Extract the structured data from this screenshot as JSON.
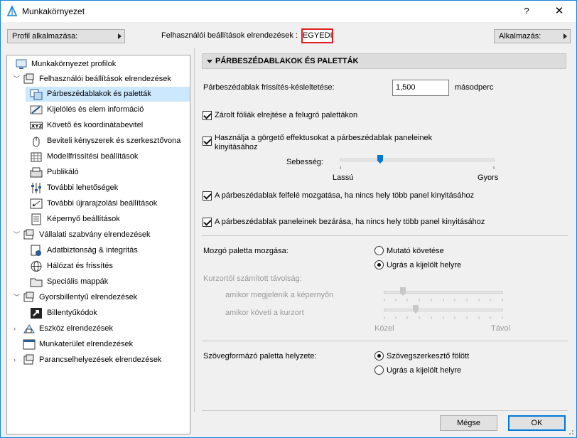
{
  "window": {
    "title": "Munkakörnyezet",
    "help": "?",
    "close": "✕"
  },
  "toolbar": {
    "profile_button": "Profil alkalmazása:",
    "current_label": "Felhasználói beállítások elrendezések :",
    "current_value": "EGYEDI",
    "apply_button": "Alkalmazás:"
  },
  "tree": {
    "items": [
      {
        "label": "Munkakörnyezet profilok",
        "icon": "profiles-icon"
      },
      {
        "label": "Felhasználói beállítások elrendezések",
        "icon": "user-settings-icon"
      },
      {
        "label": "Párbeszédablakok és paletták",
        "icon": "dialogs-palettes-icon"
      },
      {
        "label": "Kijelölés és elem információ",
        "icon": "selection-icon"
      },
      {
        "label": "Követő és koordinátabevitel",
        "icon": "xyz-icon"
      },
      {
        "label": "Beviteli kényszerek és szerkesztővona",
        "icon": "mouse-icon"
      },
      {
        "label": "Modellfrissítési beállítások",
        "icon": "model-update-icon"
      },
      {
        "label": "Publikáló",
        "icon": "publisher-icon"
      },
      {
        "label": "További lehetőségek",
        "icon": "sliders-icon"
      },
      {
        "label": "További újrarajzolási beállítások",
        "icon": "redraw-icon"
      },
      {
        "label": "Képernyő beállítások",
        "icon": "screen-icon"
      },
      {
        "label": "Vállalati szabvány elrendezések",
        "icon": "company-standards-icon"
      },
      {
        "label": "Adatbiztonság & integritás",
        "icon": "data-safety-icon"
      },
      {
        "label": "Hálózat és frissítés",
        "icon": "globe-icon"
      },
      {
        "label": "Speciális mappák",
        "icon": "folder-icon"
      },
      {
        "label": "Gyorsbillentyű elrendezések",
        "icon": "shortcuts-icon"
      },
      {
        "label": "Billentyűkódok",
        "icon": "keyboard-icon"
      },
      {
        "label": "Eszköz elrendezések",
        "icon": "tools-icon"
      },
      {
        "label": "Munkaterület elrendezések",
        "icon": "workspace-icon"
      },
      {
        "label": "Parancselhelyezések elrendezések",
        "icon": "commands-icon"
      }
    ]
  },
  "panel": {
    "header": "PÁRBESZÉDABLAKOK ÉS PALETTÁK",
    "refresh_label": "Párbeszédablak frissítés-késleltetése:",
    "refresh_value": "1,500",
    "refresh_unit": "másodperc",
    "cb_hide_layers": "Zárolt fóliák elrejtése a felugró palettákon",
    "cb_scroll_effects_1": "Használja a görgető effektusokat a párbeszédablak paneleinek",
    "cb_scroll_effects_2": "kinyitásához",
    "speed_label": "Sebesség:",
    "speed_slow": "Lassú",
    "speed_fast": "Gyors",
    "speed_level": 0.26,
    "cb_move_up": "A párbeszédablak felfelé mozgatása, ha nincs hely több panel kinyitásához",
    "cb_close_panels": "A párbeszédablak paneleinek bezárása, ha nincs hely több panel kinyitásához",
    "moving_palette_label": "Mozgó paletta mozgása:",
    "radio_follow": "Mutató követése",
    "radio_jump": "Ugrás a kijelölt helyre",
    "cursor_distance_label": "Kurzortól számított távolság:",
    "appear_label": "amikor megjelenik a képernyőn",
    "follow_label": "amikor követi a kurzort",
    "near_label": "Közel",
    "far_label": "Távol",
    "appear_level": 0.16,
    "follow_level": 0.27,
    "text_palette_label": "Szövegformázó paletta helyzete:",
    "radio_above_editor": "Szövegszerkesztő fölött",
    "radio_jump2": "Ugrás a kijelölt helyre"
  },
  "buttons": {
    "cancel": "Mégse",
    "ok": "OK"
  },
  "colors": {
    "accent": "#0078d7",
    "highlight": "#cce8ff",
    "selected_border": "#e02020"
  }
}
